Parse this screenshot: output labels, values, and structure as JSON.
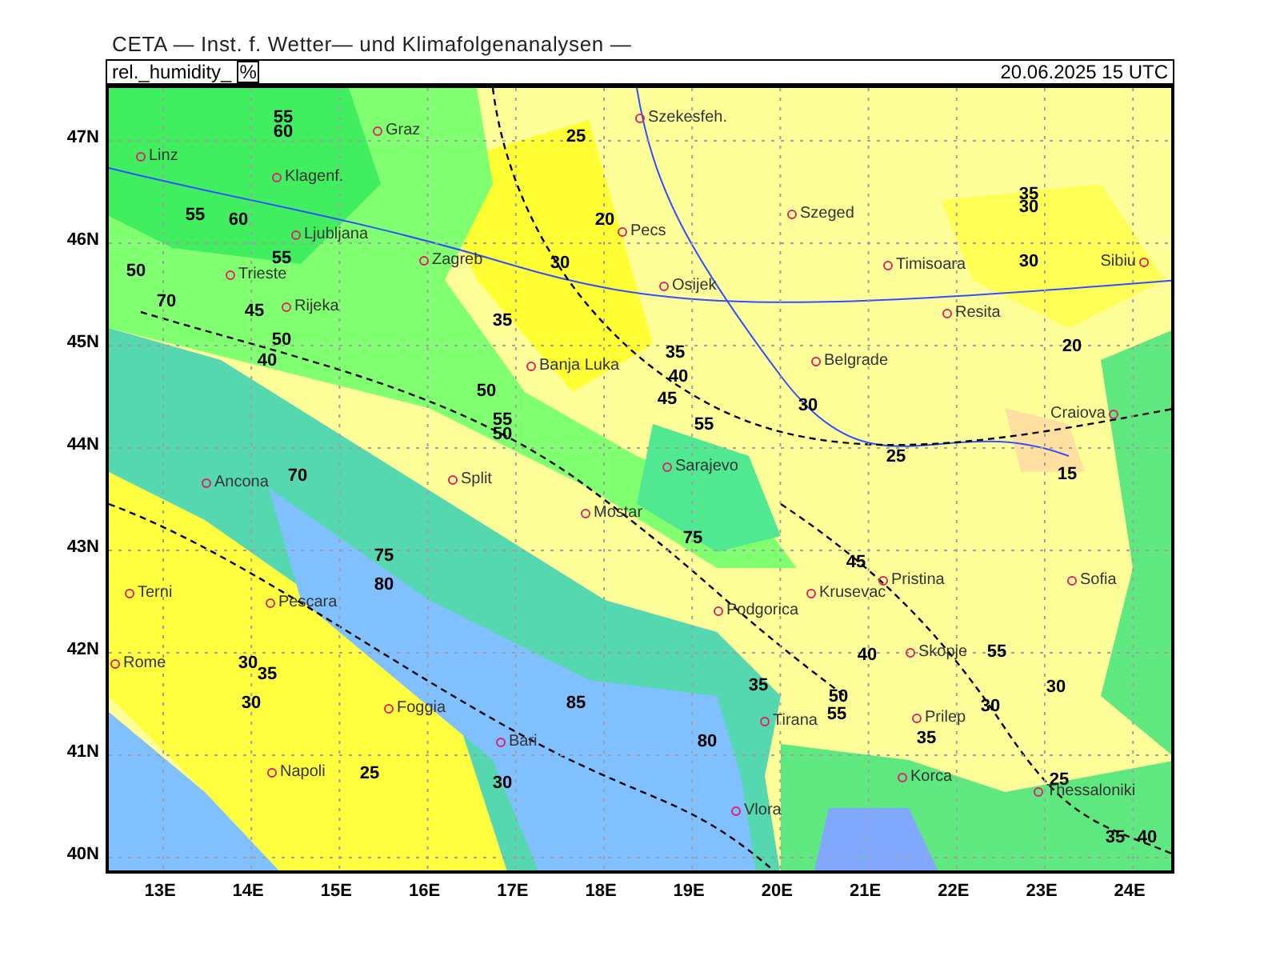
{
  "header": {
    "title": "CETA — Inst. f. Wetter— und Klimafolgenanalysen —"
  },
  "title_bar": {
    "variable": "rel._humidity_",
    "unit": "%",
    "timestamp": "20.06.2025 15 UTC"
  },
  "map": {
    "latitude_ticks": [
      "47N",
      "46N",
      "45N",
      "44N",
      "43N",
      "42N",
      "41N",
      "40N"
    ],
    "longitude_ticks": [
      "13E",
      "14E",
      "15E",
      "16E",
      "17E",
      "18E",
      "19E",
      "20E",
      "21E",
      "22E",
      "23E",
      "24E"
    ],
    "cities": [
      "Linz",
      "Graz",
      "Szekesfeh.",
      "Klagenf.",
      "Ljubljana",
      "Zagreb",
      "Pecs",
      "Szeged",
      "Trieste",
      "Rijeka",
      "Osijek",
      "Timisoara",
      "Resita",
      "Sibiu",
      "Banja Luka",
      "Belgrade",
      "Craiova",
      "Split",
      "Sarajevo",
      "Mostar",
      "Ancona",
      "Terni",
      "Pescara",
      "Rome",
      "Podgorica",
      "Krusevac",
      "Pristina",
      "Skopje",
      "Sofia",
      "Foggia",
      "Tirana",
      "Prilep",
      "Napoli",
      "Bari",
      "Vlora",
      "Korca",
      "Thessaloniki"
    ],
    "contour_labels": [
      "55",
      "60",
      "25",
      "55",
      "60",
      "20",
      "55",
      "30",
      "50",
      "70",
      "45",
      "35",
      "50",
      "40",
      "50",
      "55",
      "50",
      "70",
      "35",
      "40",
      "45",
      "55",
      "30",
      "20",
      "35",
      "30",
      "30",
      "25",
      "15",
      "75",
      "80",
      "75",
      "85",
      "80",
      "30",
      "35",
      "30",
      "25",
      "30",
      "45",
      "40",
      "35",
      "50",
      "55",
      "30",
      "35",
      "55",
      "30",
      "25",
      "35",
      "40"
    ]
  }
}
